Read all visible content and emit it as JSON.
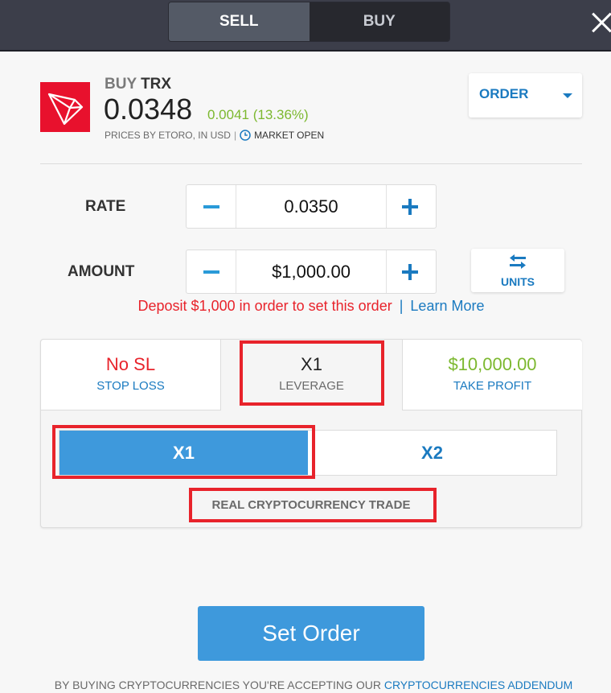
{
  "header": {
    "tabs": [
      {
        "label": "SELL",
        "active": true
      },
      {
        "label": "BUY",
        "active": false
      }
    ],
    "close_icon": "close-icon"
  },
  "instrument": {
    "logo_icon": "tron-logo-icon",
    "logo_color": "#e8112d",
    "action": "BUY",
    "symbol": "TRX",
    "price": "0.0348",
    "change": "0.0041 (13.36%)",
    "change_color": "#7cb82f",
    "source": "PRICES BY ETORO, IN USD",
    "separator": "|",
    "market_icon": "clock-icon",
    "market_status": "MARKET OPEN"
  },
  "order_type": {
    "label": "ORDER",
    "icon": "caret-down-icon"
  },
  "rate": {
    "label": "RATE",
    "value": "0.0350"
  },
  "amount": {
    "label": "AMOUNT",
    "value": "$1,000.00"
  },
  "units_button": {
    "icon": "swap-arrows-icon",
    "label": "UNITS"
  },
  "notice": {
    "warning": "Deposit $1,000 in order to set this order",
    "separator": "|",
    "link": "Learn More",
    "warning_color": "#e8232b"
  },
  "panel": {
    "tabs": [
      {
        "value": "No SL",
        "label": "STOP LOSS"
      },
      {
        "value": "X1",
        "label": "LEVERAGE"
      },
      {
        "value": "$10,000.00",
        "label": "TAKE PROFIT"
      }
    ],
    "leverage_options": [
      {
        "label": "X1",
        "selected": true
      },
      {
        "label": "X2",
        "selected": false
      }
    ],
    "trade_type": "REAL CRYPTOCURRENCY TRADE"
  },
  "submit": {
    "label": "Set Order",
    "color": "#3e99dc"
  },
  "footer": {
    "text": "BY BUYING CRYPTOCURRENCIES YOU'RE ACCEPTING OUR",
    "link": "CRYPTOCURRENCIES ADDENDUM"
  },
  "highlight_color": "#e8232b"
}
